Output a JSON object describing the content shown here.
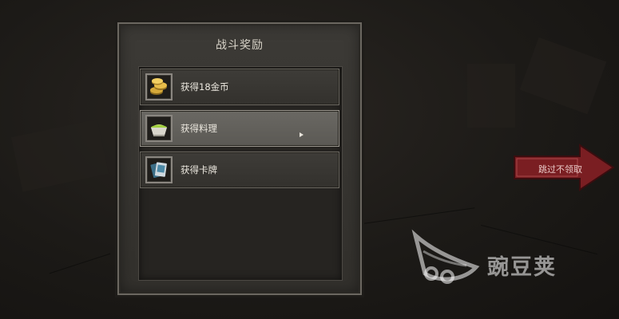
{
  "dialog": {
    "title": "战斗奖励",
    "rewards": [
      {
        "label": "获得18金币",
        "icon": "gold-coins-icon",
        "selected": false
      },
      {
        "label": "获得料理",
        "icon": "food-bowl-icon",
        "selected": true
      },
      {
        "label": "获得卡牌",
        "icon": "card-deck-icon",
        "selected": false
      }
    ]
  },
  "skip_button": {
    "label": "跳过不领取",
    "color": "#7a1e22"
  },
  "watermark": {
    "text": "豌豆荚"
  },
  "colors": {
    "panel": "#3a3834",
    "panel_border": "#6b6760",
    "selected_row": "#67655f",
    "text": "#ece8df"
  }
}
